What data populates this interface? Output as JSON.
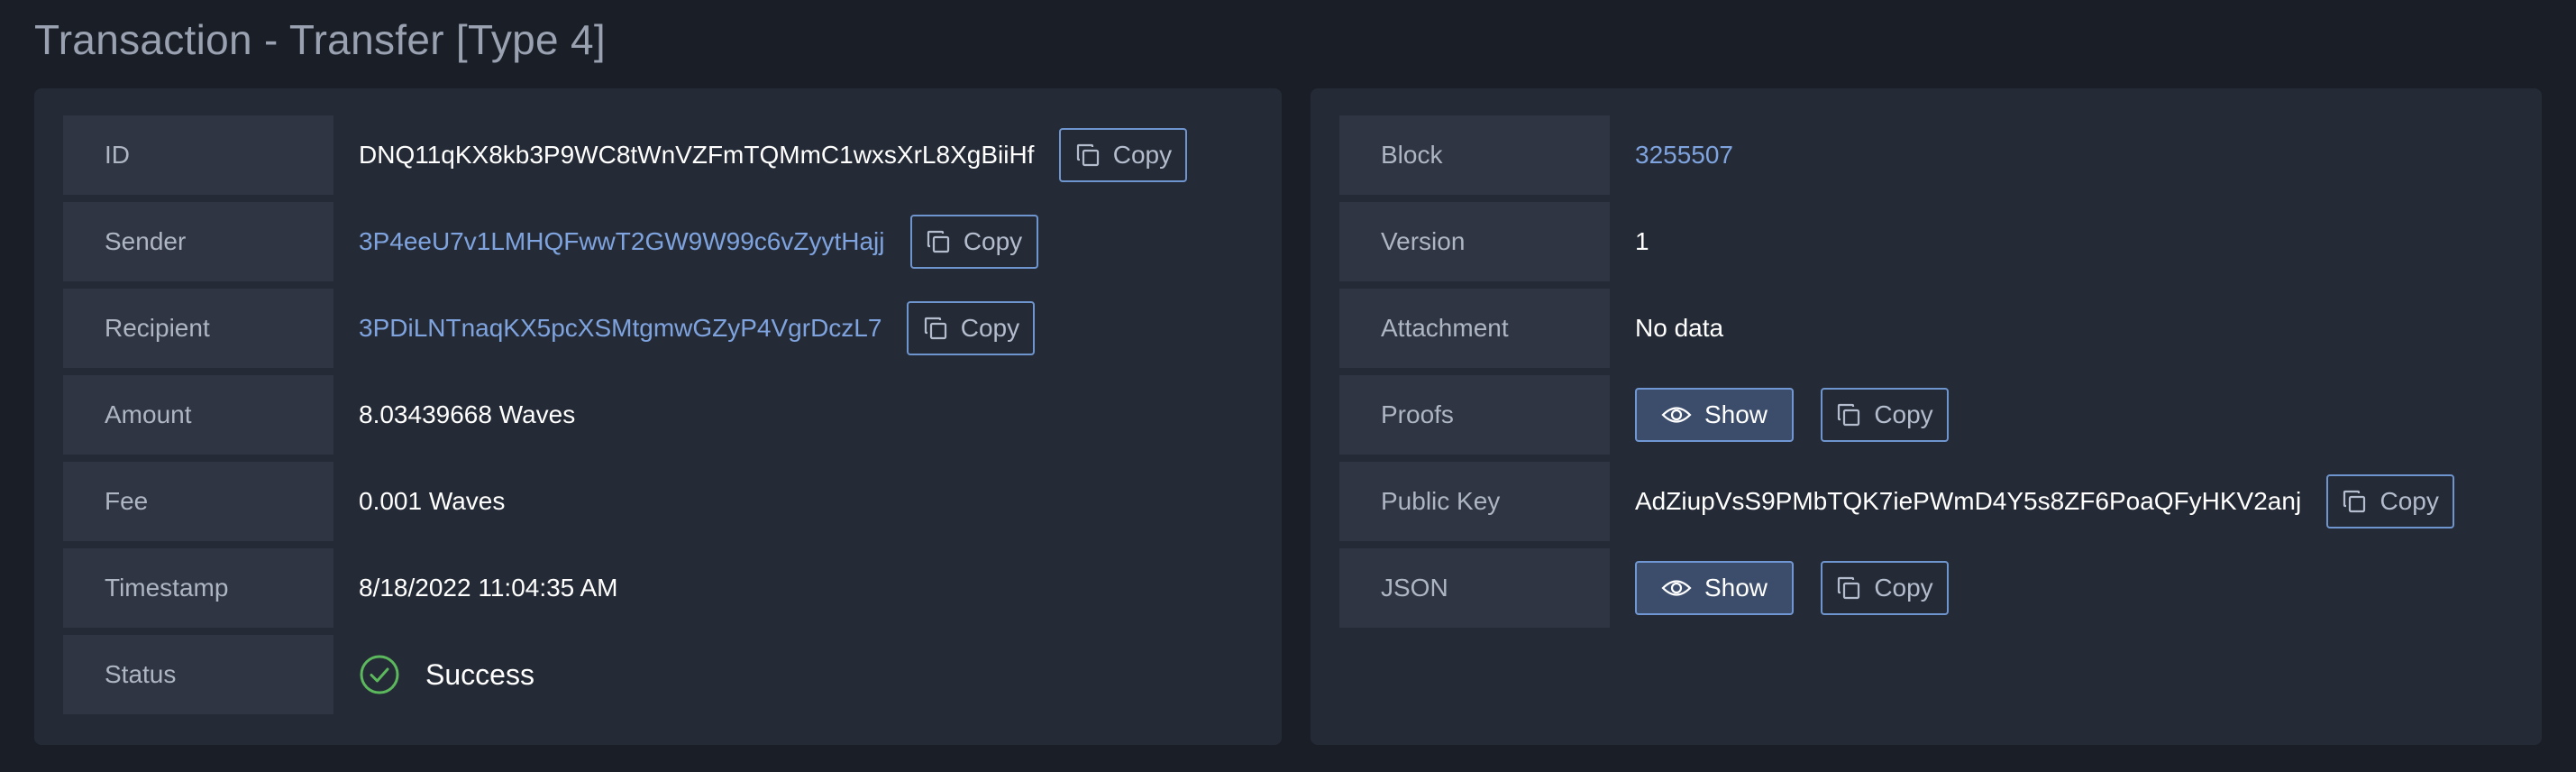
{
  "page": {
    "title": "Transaction - Transfer [Type 4]"
  },
  "left_panel": {
    "rows": [
      {
        "label": "ID",
        "value": "DNQ11qKX8kb3P9WC8tWnVZFmTQMmC1wxsXrL8XgBiiHf",
        "copy_label": "Copy"
      },
      {
        "label": "Sender",
        "value": "3P4eeU7v1LMHQFwwT2GW9W99c6vZyytHajj",
        "copy_label": "Copy"
      },
      {
        "label": "Recipient",
        "value": "3PDiLNTnaqKX5pcXSMtgmwGZyP4VgrDczL7",
        "copy_label": "Copy"
      },
      {
        "label": "Amount",
        "value": "8.03439668 Waves"
      },
      {
        "label": "Fee",
        "value": "0.001 Waves"
      },
      {
        "label": "Timestamp",
        "value": "8/18/2022 11:04:35 AM"
      },
      {
        "label": "Status",
        "value": "Success"
      }
    ]
  },
  "right_panel": {
    "rows": [
      {
        "label": "Block",
        "value": "3255507"
      },
      {
        "label": "Version",
        "value": "1"
      },
      {
        "label": "Attachment",
        "value": "No data"
      },
      {
        "label": "Proofs",
        "show_label": "Show",
        "copy_label": "Copy"
      },
      {
        "label": "Public Key",
        "value": "AdZiupVsS9PMbTQK7iePWmD4Y5s8ZF6PoaQFyHKV2anj",
        "copy_label": "Copy"
      },
      {
        "label": "JSON",
        "show_label": "Show",
        "copy_label": "Copy"
      }
    ]
  },
  "icons": {
    "copy": "copy-icon",
    "show": "eye-icon",
    "status": "check-circle-icon"
  },
  "colors": {
    "background": "#1a1e26",
    "panel": "#252b36",
    "label_cell": "#2f3542",
    "link": "#7ea3de",
    "button_border": "#6f95cf",
    "success": "#5cb85c"
  }
}
